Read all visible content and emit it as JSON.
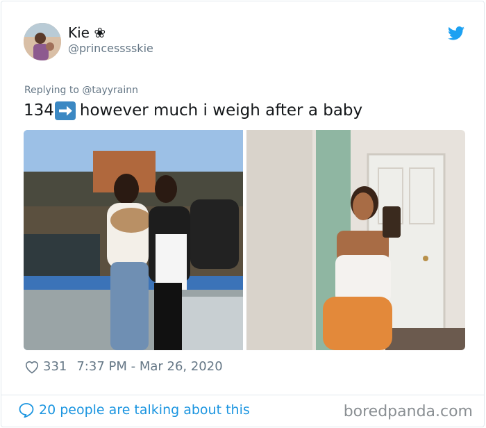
{
  "tweet": {
    "display_name": "Kie ❀",
    "handle": "@princesssskie",
    "replying_to": "Replying to @tayyrainn",
    "text_number": "134",
    "text_rest": " however much i weigh after a baby",
    "like_count": "331",
    "timestamp": "7:37 PM - Mar 26, 2020",
    "talking": "20 people are talking about this"
  },
  "branding": {
    "watermark": "boredpanda.com",
    "twitter_blue": "#1da1f2",
    "link_blue": "#1b95e0"
  },
  "icons": {
    "bird": "twitter-bird-icon",
    "heart": "heart-icon",
    "bubble": "speech-bubble-icon",
    "arrow": "right-arrow-emoji"
  }
}
